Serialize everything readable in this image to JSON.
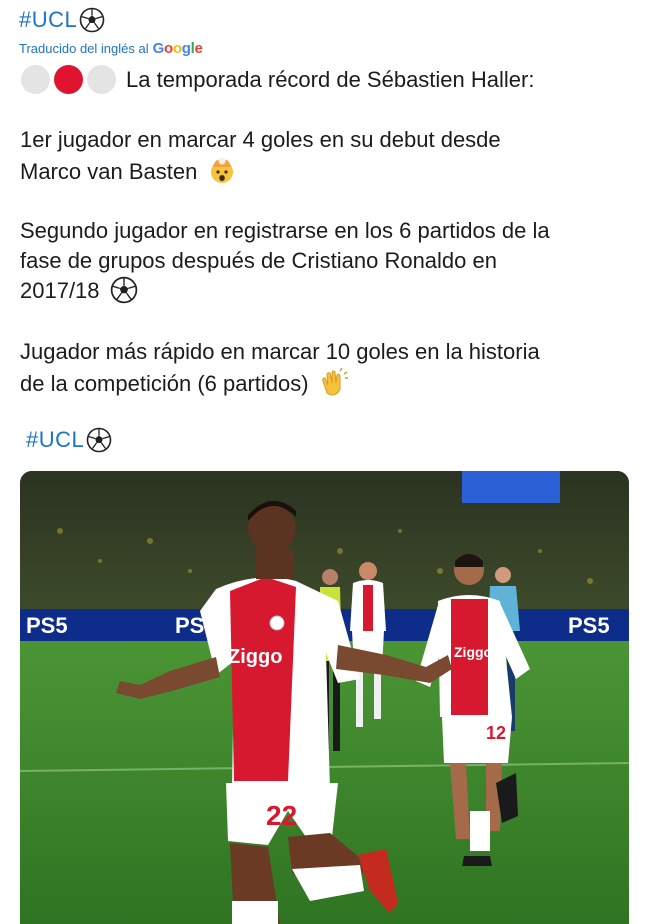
{
  "tweet": {
    "top_hashtag": "#UCL",
    "translation_note": "Traducido del inglés al",
    "google_logo": "Google",
    "headline": "La temporada récord de Sébastien Haller:",
    "para1_line1": " 1er jugador en marcar 4 goles en su debut desde",
    "para1_line2": "Marco van Basten",
    "para2_line1": " Segundo jugador en registrarse en los 6 partidos de la",
    "para2_line2": "fase de grupos después de Cristiano Ronaldo en",
    "para2_line3": "2017/18",
    "para3_line1": " Jugador más rápido en marcar 10 goles en la historia",
    "para3_line2": "de la competición (6 partidos)",
    "bottom_hashtag": "#UCL",
    "dots": [
      "grey",
      "red",
      "grey"
    ],
    "colors": {
      "link": "#1d74c9",
      "ajax_red": "#d7192f",
      "pitch": "#3f8a2f"
    }
  },
  "photo": {
    "board_text_left": "PS5",
    "board_text_mid": "PS5",
    "board_text_right": "PS5",
    "sponsor": "Ziggo",
    "sponsor2": "Ziggo",
    "shirt_number_main": "22",
    "shirt_number_second": "12"
  },
  "icons": [
    "soccer-ball-icon",
    "exploding-head-emoji",
    "clapping-hands-emoji",
    "google-logo"
  ]
}
